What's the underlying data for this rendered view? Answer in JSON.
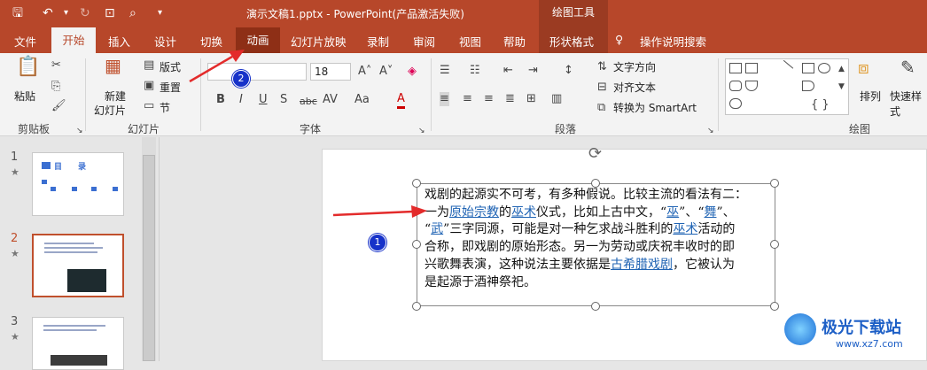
{
  "window": {
    "title": "演示文稿1.pptx  -  PowerPoint(产品激活失败)",
    "tool_tab": "绘图工具"
  },
  "quick_access": {
    "save_icon": "save-icon",
    "undo_icon": "undo-icon",
    "redo_icon": "redo-icon",
    "present_icon": "present-icon",
    "preview_icon": "print-preview-icon",
    "more_icon": "customize-icon"
  },
  "tabs": [
    "文件",
    "开始",
    "插入",
    "设计",
    "切换",
    "动画",
    "幻灯片放映",
    "录制",
    "审阅",
    "视图",
    "帮助",
    "形状格式",
    "操作说明搜索"
  ],
  "ribbon": {
    "clipboard": {
      "paste": "粘贴",
      "group": "剪贴板"
    },
    "slides": {
      "new_slide": "新建",
      "new_slide2": "幻灯片",
      "layout": "版式",
      "reset": "重置",
      "section": "节",
      "group": "幻灯片"
    },
    "font": {
      "font_name": "",
      "font_size": "18",
      "group": "字体",
      "bold": "B",
      "italic": "I",
      "underline": "U",
      "shadow": "S",
      "strike": "abc",
      "spacing": "AV",
      "case": "Aa",
      "font_color": "A"
    },
    "paragraph": {
      "text_direction": "文字方向",
      "align_text": "对齐文本",
      "smartart": "转换为 SmartArt",
      "group": "段落"
    },
    "drawing": {
      "arrange": "排列",
      "quick_styles": "快速样式",
      "group": "绘图"
    }
  },
  "slides_panel": {
    "slides": [
      {
        "number": "1",
        "title": "目　　录"
      },
      {
        "number": "2"
      },
      {
        "number": "3"
      }
    ]
  },
  "text_box": {
    "line1": "戏剧的起源实不可考，有多种假说。比较主流的看法有二：",
    "l2a": "一为",
    "l2_link1": "原始宗教",
    "l2b": "的",
    "l2_link2": "巫术",
    "l2c": "仪式，比如上古中文，“",
    "l2_link3": "巫",
    "l2d": "”、“",
    "l2_link4": "舞",
    "l2e": "”、",
    "l3a": "“",
    "l3_link1": "武",
    "l3b": "”三字同源，可能是对一种乞求战斗胜利的",
    "l3_link2": "巫术",
    "l3c": "活动的",
    "line4": "合称，即戏剧的原始形态。另一为劳动或庆祝丰收时的即",
    "l5a": "兴歌舞表演，这种说法主要依据是",
    "l5_link": "古希腊戏剧",
    "l5b": "，它被认为",
    "line6": "是起源于酒神祭祀。"
  },
  "annotations": {
    "badge1": "1",
    "badge2": "2"
  },
  "watermark": {
    "name": "极光下载站",
    "url": "www.xz7.com"
  }
}
